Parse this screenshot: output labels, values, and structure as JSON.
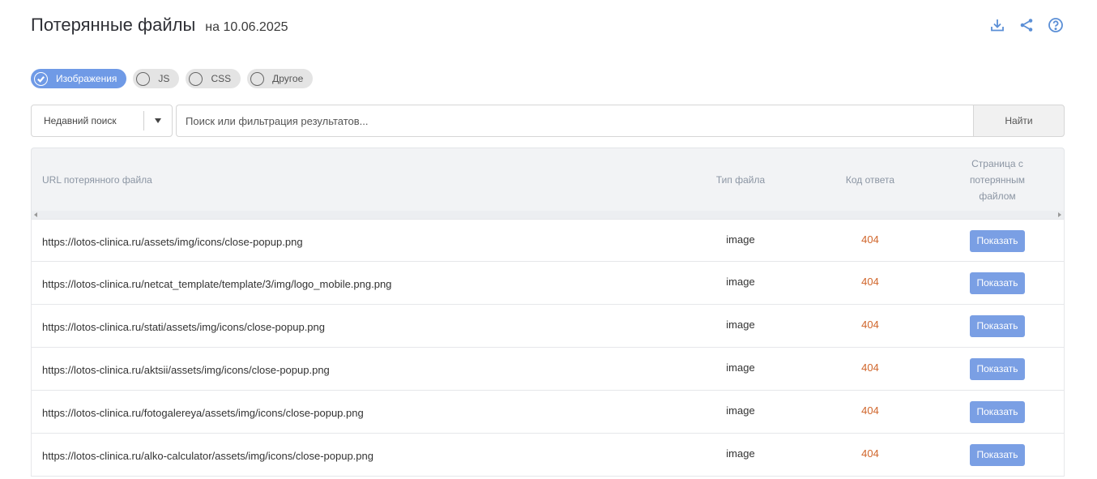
{
  "header": {
    "title": "Потерянные файлы",
    "date": "на 10.06.2025",
    "icons": [
      "download-icon",
      "share-icon",
      "help-icon"
    ],
    "accent_color": "#5b8fd6"
  },
  "filters": [
    {
      "label": "Изображения",
      "active": true
    },
    {
      "label": "JS",
      "active": false
    },
    {
      "label": "CSS",
      "active": false
    },
    {
      "label": "Другое",
      "active": false
    }
  ],
  "search": {
    "recent_label": "Недавний поиск",
    "placeholder": "Поиск или фильтрация результатов...",
    "find_label": "Найти"
  },
  "table": {
    "headers": {
      "url": "URL потерянного файла",
      "type": "Тип файла",
      "code": "Код ответа",
      "page": "Страница с потерянным файлом"
    },
    "rows": [
      {
        "url": "https://lotos-clinica.ru/assets/img/icons/close-popup.png",
        "type": "image",
        "code": "404",
        "action": "Показать"
      },
      {
        "url": "https://lotos-clinica.ru/netcat_template/template/3/img/logo_mobile.png.png",
        "type": "image",
        "code": "404",
        "action": "Показать"
      },
      {
        "url": "https://lotos-clinica.ru/stati/assets/img/icons/close-popup.png",
        "type": "image",
        "code": "404",
        "action": "Показать"
      },
      {
        "url": "https://lotos-clinica.ru/aktsii/assets/img/icons/close-popup.png",
        "type": "image",
        "code": "404",
        "action": "Показать"
      },
      {
        "url": "https://lotos-clinica.ru/fotogalereya/assets/img/icons/close-popup.png",
        "type": "image",
        "code": "404",
        "action": "Показать"
      },
      {
        "url": "https://lotos-clinica.ru/alko-calculator/assets/img/icons/close-popup.png",
        "type": "image",
        "code": "404",
        "action": "Показать"
      }
    ]
  },
  "colors": {
    "chip_active": "#6f9ae6",
    "button": "#7a9fe4",
    "code_404": "#d0652a"
  }
}
